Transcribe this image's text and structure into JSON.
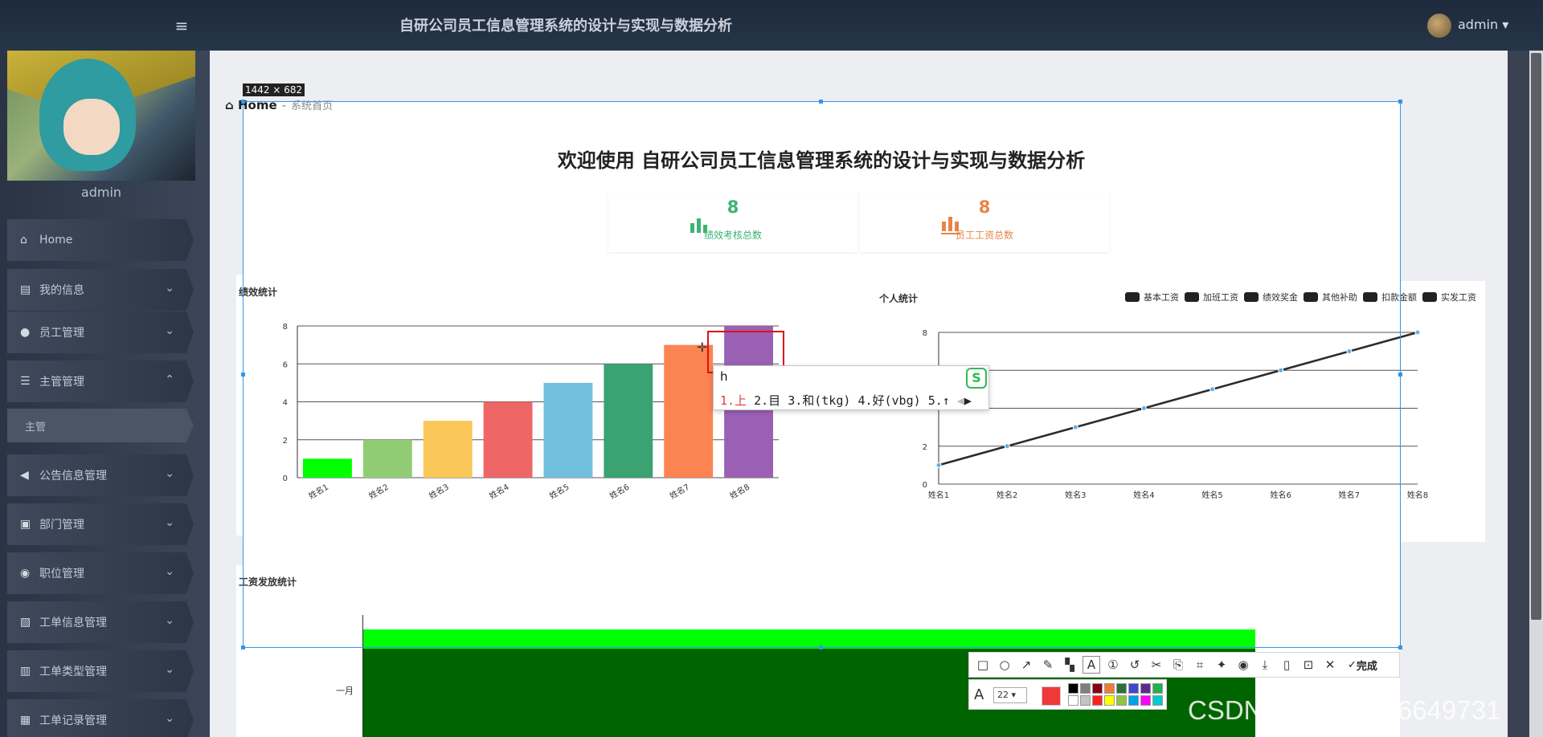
{
  "header": {
    "title": "自研公司员工信息管理系统的设计与实现与数据分析",
    "user": "admin ▾"
  },
  "sidebar": {
    "username": "admin",
    "items": [
      {
        "label": "Home",
        "icon": "home-icon"
      },
      {
        "label": "我的信息",
        "icon": "profile-icon"
      },
      {
        "label": "员工管理",
        "icon": "user-icon"
      },
      {
        "label": "主管管理",
        "icon": "list-icon"
      },
      {
        "label": "公告信息管理",
        "icon": "megaphone-icon"
      },
      {
        "label": "部门管理",
        "icon": "briefcase-icon"
      },
      {
        "label": "职位管理",
        "icon": "pin-icon"
      },
      {
        "label": "工单信息管理",
        "icon": "ticket-icon"
      },
      {
        "label": "工单类型管理",
        "icon": "clipboard-icon"
      },
      {
        "label": "工单记录管理",
        "icon": "grid-icon"
      }
    ],
    "subitem": "主管"
  },
  "breadcrumb": {
    "home": "Home",
    "sep": "-",
    "current": "系统首页"
  },
  "welcome": "欢迎使用 自研公司员工信息管理系统的设计与实现与数据分析",
  "stats": [
    {
      "value": "8",
      "label": "绩效考核总数",
      "color": "#3cb371"
    },
    {
      "value": "8",
      "label": "员工工资总数",
      "color": "#e8844a"
    }
  ],
  "charts": {
    "bar_title": "绩效统计",
    "line_title": "个人统计",
    "bottom_title": "工资发放统计",
    "bottom_category": "一月"
  },
  "chart_data": [
    {
      "type": "bar",
      "title": "绩效统计",
      "categories": [
        "姓名1",
        "姓名2",
        "姓名3",
        "姓名4",
        "姓名5",
        "姓名6",
        "姓名7",
        "姓名8"
      ],
      "values": [
        1,
        2,
        3,
        4,
        5,
        6,
        7,
        8
      ],
      "colors": [
        "#00ff00",
        "#91cc75",
        "#fac858",
        "#ee6666",
        "#73c0de",
        "#3ba272",
        "#fc8452",
        "#9a60b4"
      ],
      "ylim": [
        0,
        8
      ],
      "yticks": [
        "0",
        "2",
        "4",
        "6",
        "8"
      ],
      "grid": true
    },
    {
      "type": "line",
      "title": "个人统计",
      "categories": [
        "姓名1",
        "姓名2",
        "姓名3",
        "姓名4",
        "姓名5",
        "姓名6",
        "姓名7",
        "姓名8"
      ],
      "values": [
        1,
        2,
        3,
        4,
        5,
        6,
        7,
        8
      ],
      "ylim": [
        0,
        8
      ],
      "yticks": [
        "0",
        "2",
        "",
        "",
        "8"
      ],
      "legend": [
        "基本工资",
        "加班工资",
        "绩效奖金",
        "其他补助",
        "扣款金额",
        "实发工资"
      ],
      "legend_position": "top-right",
      "grid": true
    },
    {
      "type": "bar",
      "orientation": "horizontal",
      "title": "工资发放统计",
      "categories": [
        "一月"
      ],
      "series": [
        {
          "values": [
            8
          ],
          "color": "#00ff00"
        },
        {
          "values": [
            8
          ],
          "color": "#006400"
        }
      ]
    }
  ],
  "screenshot_tool": {
    "size_label": "1442 × 682",
    "ime_input": "h",
    "ime_candidates": [
      "1.上",
      "2.目",
      "3.和(tkg)",
      "4.好(vbg)",
      "5.↑"
    ],
    "tools": [
      "rect-icon",
      "ellipse-icon",
      "arrow-icon",
      "pen-icon",
      "mosaic-icon",
      "text-icon",
      "number-icon",
      "undo-icon",
      "cut-icon",
      "translate-icon",
      "ocr-icon",
      "pin-icon",
      "record-icon",
      "download-icon",
      "phone-icon",
      "bookmark-icon",
      "close-icon"
    ],
    "done_label": "完成",
    "font_size": "22",
    "current_color": "#f03838",
    "palette": [
      "#000000",
      "#7f7f7f",
      "#880015",
      "#ed7d31",
      "#2f6f3f",
      "#3f48cc",
      "#5b2c8f",
      "#22b14c",
      "#ffffff",
      "#c3c3c3",
      "#ff2020",
      "#ffff00",
      "#8ec63f",
      "#00a2e8",
      "#ff00ff",
      "#00cccc"
    ]
  },
  "watermark": "CSDN @QQ_3786649731"
}
